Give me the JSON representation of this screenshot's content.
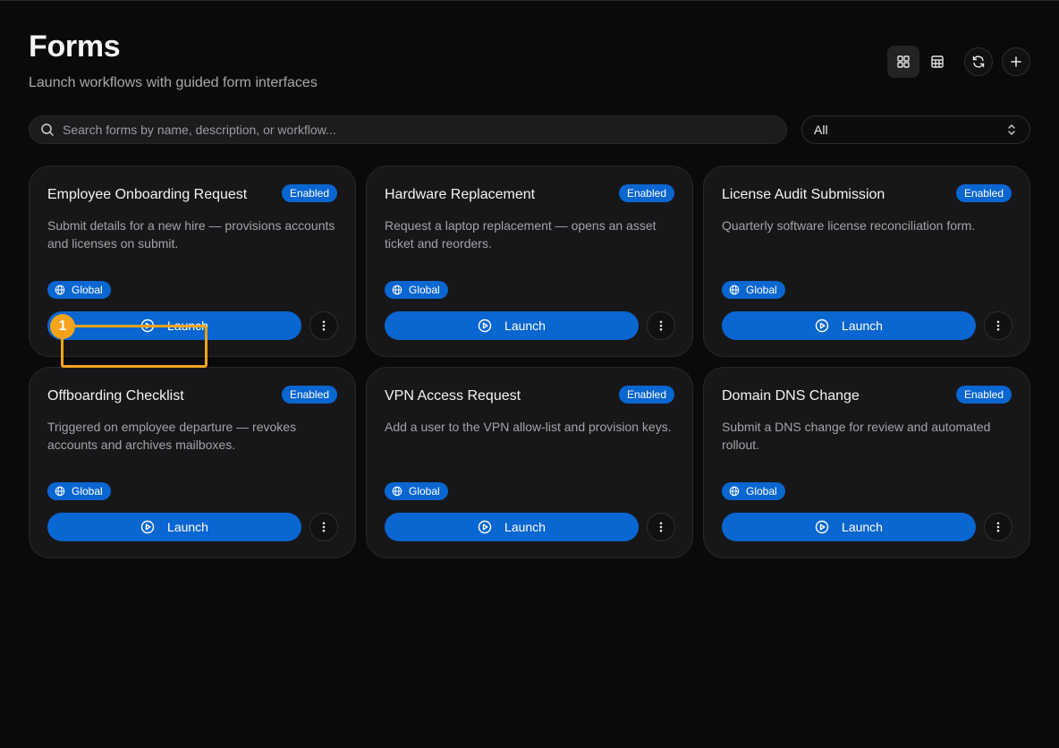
{
  "header": {
    "title": "Forms",
    "subtitle": "Launch workflows with guided form interfaces"
  },
  "toolbar": {
    "grid_view_icon": "grid-icon",
    "table_view_icon": "table-icon",
    "refresh_icon": "refresh-icon",
    "add_icon": "plus-icon",
    "active_view": "grid"
  },
  "search": {
    "placeholder": "Search forms by name, description, or workflow...",
    "value": ""
  },
  "filter": {
    "selected": "All"
  },
  "forms": [
    {
      "title": "Employee Onboarding Request",
      "status": "Enabled",
      "description": "Submit details for a new hire — provisions accounts and licenses on submit.",
      "scope": "Global",
      "launch_label": "Launch"
    },
    {
      "title": "Hardware Replacement",
      "status": "Enabled",
      "description": "Request a laptop replacement — opens an asset ticket and reorders.",
      "scope": "Global",
      "launch_label": "Launch"
    },
    {
      "title": "License Audit Submission",
      "status": "Enabled",
      "description": "Quarterly software license reconciliation form.",
      "scope": "Global",
      "launch_label": "Launch"
    },
    {
      "title": "Offboarding Checklist",
      "status": "Enabled",
      "description": "Triggered on employee departure — revokes accounts and archives mailboxes.",
      "scope": "Global",
      "launch_label": "Launch"
    },
    {
      "title": "VPN Access Request",
      "status": "Enabled",
      "description": "Add a user to the VPN allow-list and provision keys.",
      "scope": "Global",
      "launch_label": "Launch"
    },
    {
      "title": "Domain DNS Change",
      "status": "Enabled",
      "description": "Submit a DNS change for review and automated rollout.",
      "scope": "Global",
      "launch_label": "Launch"
    }
  ],
  "annotation": {
    "label": "1"
  },
  "colors": {
    "background": "#0a0a0b",
    "card": "#171719",
    "accent": "#0a66d0",
    "highlight": "#f5a31a"
  }
}
